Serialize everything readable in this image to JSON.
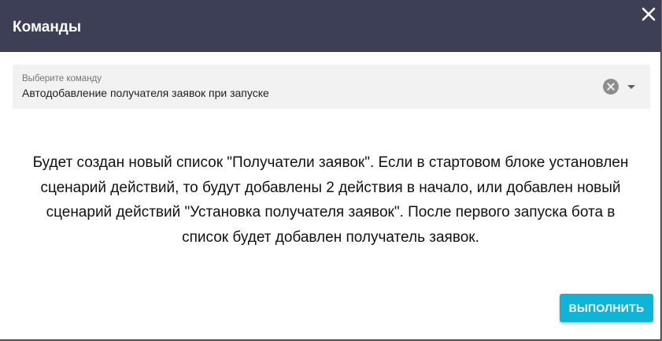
{
  "dialog": {
    "title": "Команды",
    "close_icon": "close-icon"
  },
  "select": {
    "label": "Выберите команду",
    "value": "Автодобавление получателя заявок при запуске",
    "clear_icon": "clear-circle-icon",
    "dropdown_icon": "caret-down-icon"
  },
  "description": "Будет создан новый список \"Получатели заявок\". Если в стартовом блоке установлен сценарий действий, то будут добавлены 2 действия в начало, или добавлен новый сценарий действий \"Установка получателя заявок\". После первого запуска бота в список будет добавлен получатель заявок.",
  "actions": {
    "execute_label": "ВЫПОЛНИТЬ"
  },
  "colors": {
    "header_bg": "#3c3f55",
    "field_bg": "#f2f2f2",
    "accent": "#10b4d6",
    "text": "#111111"
  }
}
